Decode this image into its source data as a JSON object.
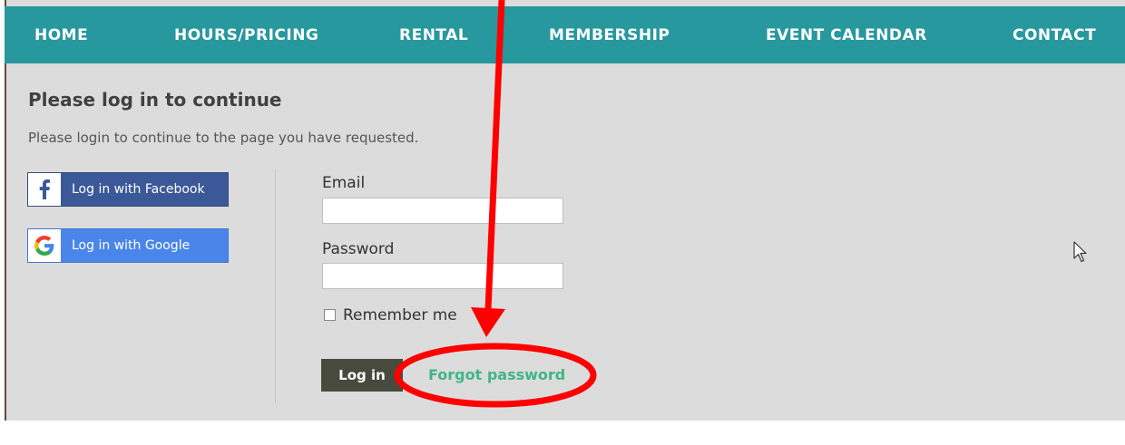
{
  "nav": {
    "items": [
      "HOME",
      "HOURS/PRICING",
      "RENTAL",
      "MEMBERSHIP",
      "EVENT CALENDAR",
      "CONTACT"
    ]
  },
  "main": {
    "title": "Please log in to continue",
    "subtitle": "Please login to continue to the page you have requested."
  },
  "social": {
    "facebook_label": "Log in with Facebook",
    "google_label": "Log in with Google"
  },
  "form": {
    "email_label": "Email",
    "email_value": "",
    "password_label": "Password",
    "password_value": "",
    "remember_label": "Remember me",
    "remember_checked": false,
    "login_label": "Log in",
    "forgot_label": "Forgot password"
  },
  "colors": {
    "nav_bg": "#26989e",
    "page_bg": "#dcdcdc",
    "facebook": "#3b5998",
    "google": "#4a86ea",
    "login_button": "#484a3e",
    "forgot_link": "#41b587",
    "annotation": "#ff0000"
  },
  "icons": {
    "facebook": "facebook-icon",
    "google": "google-icon",
    "cursor": "mouse-pointer-icon"
  }
}
